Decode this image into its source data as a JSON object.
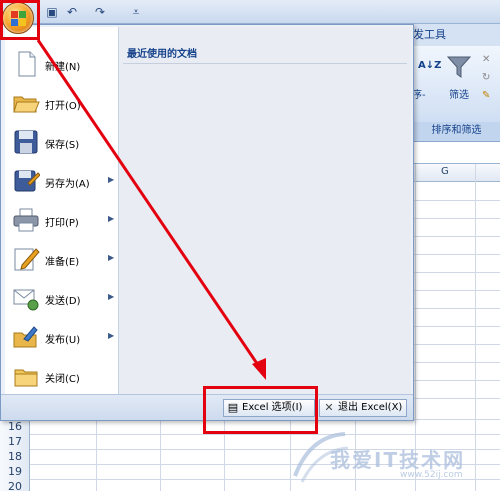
{
  "ribbon": {
    "tab_label": "发工具",
    "btn_sort_partial": "序-",
    "btn_filter": "筛选",
    "group_label": "排序和筛选"
  },
  "grid": {
    "col_g": "G",
    "rows": [
      "16",
      "17",
      "18",
      "19",
      "20"
    ]
  },
  "menu": {
    "recent_title": "最近使用的文档",
    "items": [
      {
        "label": "新建(N)",
        "icon": "new-document-icon",
        "submenu": false
      },
      {
        "label": "打开(O)",
        "icon": "open-folder-icon",
        "submenu": false
      },
      {
        "label": "保存(S)",
        "icon": "save-disk-icon",
        "submenu": false
      },
      {
        "label": "另存为(A)",
        "icon": "save-as-icon",
        "submenu": true
      },
      {
        "label": "打印(P)",
        "icon": "printer-icon",
        "submenu": true
      },
      {
        "label": "准备(E)",
        "icon": "prepare-pen-icon",
        "submenu": true
      },
      {
        "label": "发送(D)",
        "icon": "send-icon",
        "submenu": true
      },
      {
        "label": "发布(U)",
        "icon": "publish-icon",
        "submenu": true
      },
      {
        "label": "关闭(C)",
        "icon": "close-folder-icon",
        "submenu": false
      }
    ],
    "options_button": "Excel 选项(I)",
    "exit_button": "退出 Excel(X)"
  },
  "watermark": {
    "text": "我爱IT技术网",
    "url": "www.52ij.com"
  },
  "colors": {
    "annotation_red": "#e3000f",
    "menu_bg": "#ecf1f9",
    "accent_blue": "#15428b"
  }
}
